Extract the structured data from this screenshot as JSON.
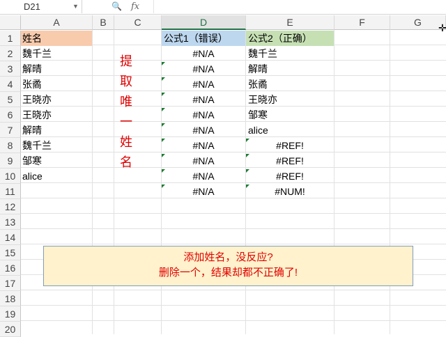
{
  "formula_bar": {
    "name_box": "D21",
    "zoom_icon": "zoom-icon",
    "fx_label": "fx",
    "formula": ""
  },
  "columns": [
    "A",
    "B",
    "C",
    "D",
    "E",
    "F",
    "G"
  ],
  "rows": [
    "1",
    "2",
    "3",
    "4",
    "5",
    "6",
    "7",
    "8",
    "9",
    "10",
    "11",
    "12",
    "13",
    "14",
    "15",
    "16",
    "17",
    "18",
    "19",
    "20"
  ],
  "cells": {
    "A": [
      "姓名",
      "魏千兰",
      "解晴",
      "张矞",
      "王晓亦",
      "王晓亦",
      "解晴",
      "魏千兰",
      "邹寒",
      "alice"
    ],
    "D": [
      "公式1（错误）",
      "#N/A",
      "#N/A",
      "#N/A",
      "#N/A",
      "#N/A",
      "#N/A",
      "#N/A",
      "#N/A",
      "#N/A",
      "#N/A"
    ],
    "E": [
      "公式2（正确）",
      "魏千兰",
      "解晴",
      "张矞",
      "王晓亦",
      "邹寒",
      "alice",
      "#REF!",
      "#REF!",
      "#REF!",
      "#NUM!"
    ]
  },
  "side_label": [
    "提",
    "取",
    "唯",
    "一",
    "姓",
    "名"
  ],
  "note": {
    "line1": "添加姓名，没反应?",
    "line2": "删除一个，结果却都不正确了!"
  },
  "colors": {
    "header_a": "#f8cbad",
    "header_d": "#bdd7ee",
    "header_e": "#c6e0b4",
    "note_bg": "#fff2cc",
    "accent_red": "#e00000",
    "excel_green": "#217346"
  }
}
